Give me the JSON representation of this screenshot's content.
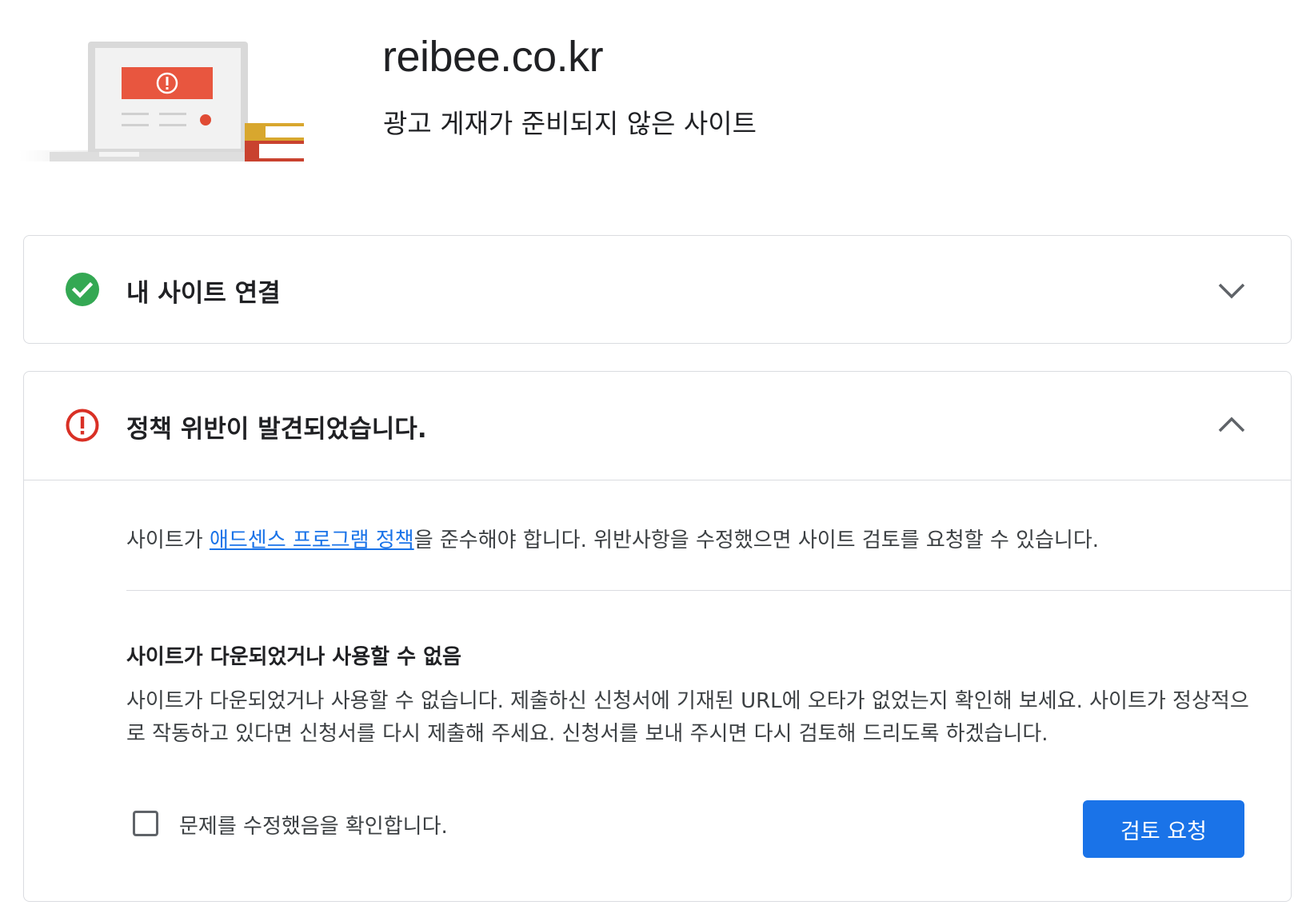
{
  "header": {
    "site_name": "reibee.co.kr",
    "status": "광고 게재가 준비되지 않은 사이트"
  },
  "sections": {
    "connect": {
      "title": "내 사이트 연결",
      "icon": "check-circle-icon",
      "icon_color": "#34a853",
      "expanded": false
    },
    "policy": {
      "title": "정책 위반이 발견되었습니다.",
      "icon": "error-circle-icon",
      "icon_color": "#d93025",
      "expanded": true,
      "intro_before": "사이트가 ",
      "intro_link": "애드센스 프로그램 정책",
      "intro_after": "을 준수해야 합니다. 위반사항을 수정했으면 사이트 검토를 요청할 수 있습니다.",
      "issue_title": "사이트가 다운되었거나 사용할 수 없음",
      "issue_description": "사이트가 다운되었거나 사용할 수 없습니다. 제출하신 신청서에 기재된 URL에 오타가 없었는지 확인해 보세요. 사이트가 정상적으로 작동하고 있다면 신청서를 다시 제출해 주세요. 신청서를 보내 주시면 다시 검토해 드리도록 하겠습니다.",
      "checkbox_label": "문제를 수정했음을 확인합니다.",
      "checkbox_checked": false,
      "button_label": "검토 요청"
    }
  },
  "colors": {
    "accent": "#1a73e8",
    "success": "#34a853",
    "error": "#d93025"
  }
}
